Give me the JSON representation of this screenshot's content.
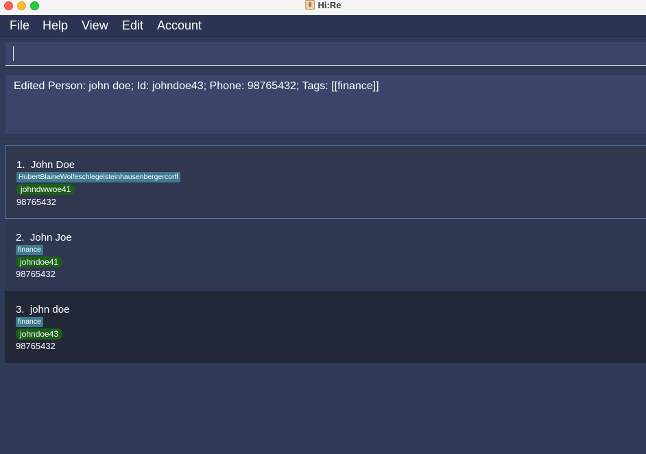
{
  "window": {
    "title": "Hi:Re"
  },
  "menu": {
    "items": [
      "File",
      "Help",
      "View",
      "Edit",
      "Account"
    ]
  },
  "command_box": {
    "value": "",
    "placeholder": ""
  },
  "result_display": {
    "text": "Edited Person: john doe; Id: johndoe43; Phone: 98765432; Tags: [[finance]]"
  },
  "person_list": [
    {
      "index": "1.",
      "name": "John Doe",
      "tag": "HubertBlaineWolfeschlegelsteinhausenbergercorff",
      "id": "johndwwoe41",
      "phone": "98765432"
    },
    {
      "index": "2.",
      "name": "John Joe",
      "tag": "finance",
      "id": "johndoe41",
      "phone": "98765432"
    },
    {
      "index": "3.",
      "name": "john doe",
      "tag": "finance",
      "id": "johndoe43",
      "phone": "98765432"
    }
  ],
  "colors": {
    "background": "#313a57",
    "tag": "#3e7b91",
    "id_badge": "#1d5f18",
    "selected_border": "#4a7fa6"
  }
}
